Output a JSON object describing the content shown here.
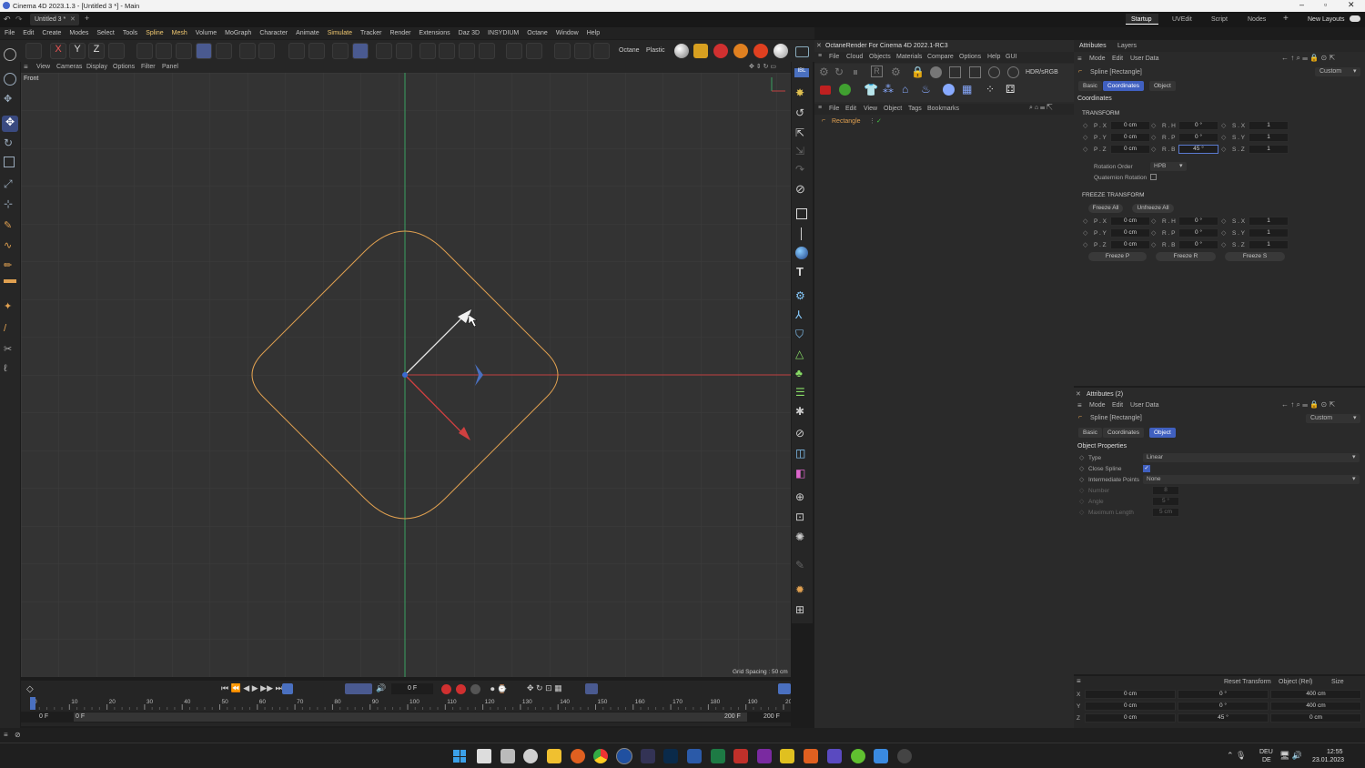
{
  "app": {
    "title": "Cinema 4D 2023.1.3 - [Untitled 3 *] - Main",
    "doc_tab": "Untitled 3 *"
  },
  "layouts": {
    "items": [
      "Startup",
      "UVEdit",
      "Script",
      "Nodes"
    ],
    "active": "Startup",
    "new_layouts": "New Layouts"
  },
  "menu": [
    "File",
    "Edit",
    "Create",
    "Modes",
    "Select",
    "Tools",
    "Spline",
    "Mesh",
    "Volume",
    "MoGraph",
    "Character",
    "Animate",
    "Simulate",
    "Tracker",
    "Render",
    "Extensions",
    "Daz 3D",
    "INSYDIUM",
    "Octane",
    "Window",
    "Help"
  ],
  "toolbar": {
    "octane": "Octane",
    "plastic": "Plastic"
  },
  "viewport": {
    "menu": [
      "View",
      "Cameras",
      "Display",
      "Options",
      "Filter",
      "Panel"
    ],
    "label": "Front",
    "grid_spacing": "Grid Spacing : 50 cm"
  },
  "octane": {
    "title": "OctaneRender For Cinema 4D 2022.1-RC3",
    "menu": [
      "File",
      "Cloud",
      "Objects",
      "Materials",
      "Compare",
      "Options",
      "Help",
      "GUI"
    ],
    "hdr": "HDR/sRGB",
    "obj_menu": [
      "File",
      "Edit",
      "View",
      "Object",
      "Tags",
      "Bookmarks"
    ],
    "object": "Rectangle"
  },
  "attr1": {
    "tabs": [
      "Attributes",
      "Layers"
    ],
    "menu": [
      "Mode",
      "Edit",
      "User Data"
    ],
    "object": "Spline [Rectangle]",
    "preset": "Custom",
    "subtabs": [
      "Basic",
      "Coordinates",
      "Object"
    ],
    "active_subtab": "Coordinates",
    "section": "Coordinates",
    "transform_title": "TRANSFORM",
    "rows": [
      [
        "P . X",
        "0 cm",
        "R . H",
        "0 °",
        "S . X",
        "1"
      ],
      [
        "P . Y",
        "0 cm",
        "R . P",
        "0 °",
        "S . Y",
        "1"
      ],
      [
        "P . Z",
        "0 cm",
        "R . B",
        "45 °",
        "S . Z",
        "1"
      ]
    ],
    "rotation_order_label": "Rotation Order",
    "rotation_order": "HPB",
    "quaternion": "Quaternion Rotation",
    "freeze_title": "FREEZE TRANSFORM",
    "freeze_all": "Freeze All",
    "unfreeze_all": "Unfreeze All",
    "frows": [
      [
        "P . X",
        "0 cm",
        "R . H",
        "0 °",
        "S . X",
        "1"
      ],
      [
        "P . Y",
        "0 cm",
        "R . P",
        "0 °",
        "S . Y",
        "1"
      ],
      [
        "P . Z",
        "0 cm",
        "R . B",
        "0 °",
        "S . Z",
        "1"
      ]
    ],
    "freeze_p": "Freeze P",
    "freeze_r": "Freeze R",
    "freeze_s": "Freeze S"
  },
  "attr2": {
    "title": "Attributes (2)",
    "menu": [
      "Mode",
      "Edit",
      "User Data"
    ],
    "object": "Spline [Rectangle]",
    "preset": "Custom",
    "subtabs": [
      "Basic",
      "Coordinates",
      "Object"
    ],
    "active_subtab": "Object",
    "section": "Object Properties",
    "props": [
      [
        "Type",
        "Linear"
      ],
      [
        "Close Spline",
        ""
      ],
      [
        "Intermediate Points",
        "None"
      ],
      [
        "Number",
        "8"
      ],
      [
        "Angle",
        "5 °"
      ],
      [
        "Maximum Length",
        "5 cm"
      ]
    ]
  },
  "coords": {
    "reset": "Reset Transform",
    "mode": "Object (Rel)",
    "size": "Size",
    "rows": [
      [
        "X",
        "0 cm",
        "0 °",
        "400 cm"
      ],
      [
        "Y",
        "0 cm",
        "0 °",
        "400 cm"
      ],
      [
        "Z",
        "0 cm",
        "45 °",
        "0 cm"
      ]
    ]
  },
  "timeline": {
    "frame": "0 F",
    "start": "0 F",
    "start2": "0 F",
    "end": "200 F",
    "end2": "200 F",
    "ticks": [
      "0",
      "10",
      "20",
      "30",
      "40",
      "50",
      "60",
      "70",
      "80",
      "90",
      "100",
      "110",
      "120",
      "130",
      "140",
      "150",
      "160",
      "170",
      "180",
      "190",
      "200"
    ]
  },
  "taskbar": {
    "lang": "DEU",
    "lang2": "DE",
    "time": "12:55",
    "date": "23.01.2023"
  },
  "colors": {
    "accent": "#4060c0",
    "spline": "#e0a050",
    "y_axis": "#3aa060",
    "x_axis": "#c04040"
  }
}
